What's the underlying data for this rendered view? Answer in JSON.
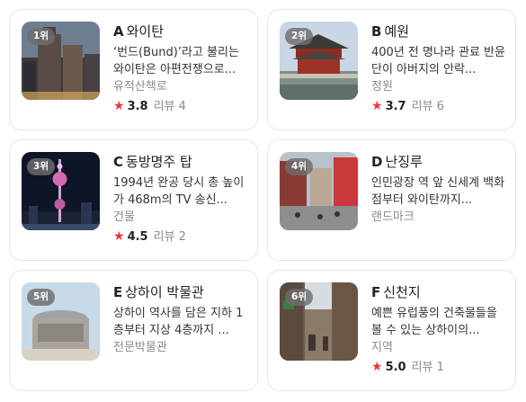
{
  "places": [
    {
      "rank": "1위",
      "letter": "A",
      "name": "와이탄",
      "description": "‘번드(Bund)’라고 불리는 와이탄은 아편전쟁으로...",
      "category": "유적산책로",
      "star_icon": "star-icon",
      "rating": "3.8",
      "reviews": "리뷰 4"
    },
    {
      "rank": "2위",
      "letter": "B",
      "name": "예원",
      "description": "400년 전 명나라 관료 반윤단이 아버지의 안락...",
      "category": "정원",
      "star_icon": "star-icon",
      "rating": "3.7",
      "reviews": "리뷰 6"
    },
    {
      "rank": "3위",
      "letter": "C",
      "name": "동방명주 탑",
      "description": "1994년 완공 당시 총 높이가 468m의 TV 송신...",
      "category": "건물",
      "star_icon": "star-icon",
      "rating": "4.5",
      "reviews": "리뷰 2"
    },
    {
      "rank": "4위",
      "letter": "D",
      "name": "난징루",
      "description": "인민광장 역 앞 신세계 백화점부터 와이탄까지...",
      "category": "랜드마크",
      "star_icon": "star-icon",
      "rating": "",
      "reviews": ""
    },
    {
      "rank": "5위",
      "letter": "E",
      "name": "상하이 박물관",
      "description": "상하이 역사를 담은 지하 1층부터 지상 4층까지 ...",
      "category": "전문박물관",
      "star_icon": "star-icon",
      "rating": "",
      "reviews": ""
    },
    {
      "rank": "6위",
      "letter": "F",
      "name": "신천지",
      "description": "예쁜 유럽풍의 건축물들을 볼 수 있는 상하이의...",
      "category": "지역",
      "star_icon": "star-icon",
      "rating": "5.0",
      "reviews": "리뷰 1"
    }
  ],
  "colors": {
    "star": "#e8363b",
    "muted_text": "#8a8a8a",
    "card_border": "#e4e4e4"
  }
}
